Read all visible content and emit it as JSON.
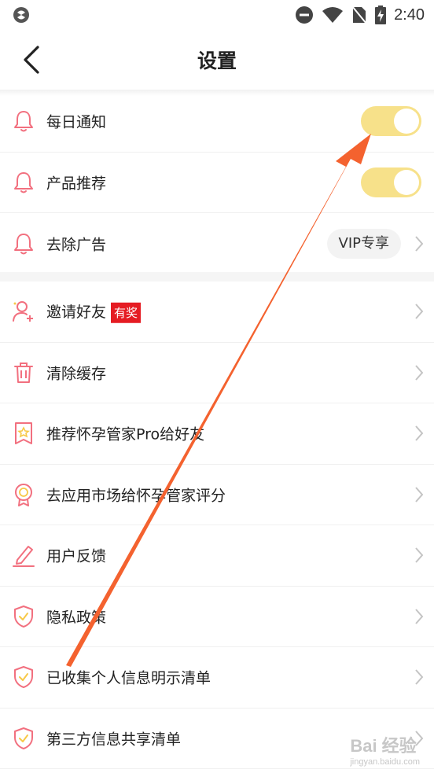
{
  "status_bar": {
    "time": "2:40",
    "icons": [
      "app-notification-icon",
      "do-not-disturb-icon",
      "wifi-icon",
      "no-sim-icon",
      "battery-charging-icon"
    ]
  },
  "header": {
    "title": "设置",
    "back_icon": "back-arrow-icon"
  },
  "colors": {
    "accent_pink": "#f2707f",
    "toggle_on": "#f7e18a",
    "badge_red": "#e51c23",
    "annotation_arrow": "#f4622f"
  },
  "section1": [
    {
      "label": "每日通知",
      "icon": "bell-icon",
      "control": "toggle",
      "state": "on"
    },
    {
      "label": "产品推荐",
      "icon": "bell-icon",
      "control": "toggle",
      "state": "on"
    },
    {
      "label": "去除广告",
      "icon": "bell-icon",
      "control": "pill",
      "pill_label": "VIP专享"
    }
  ],
  "section2": [
    {
      "label": "邀请好友",
      "icon": "add-user-icon",
      "badge": "有奖"
    },
    {
      "label": "清除缓存",
      "icon": "trash-icon"
    },
    {
      "label": "推荐怀孕管家Pro给好友",
      "icon": "share-card-icon"
    },
    {
      "label": "去应用市场给怀孕管家评分",
      "icon": "medal-icon"
    },
    {
      "label": "用户反馈",
      "icon": "pencil-icon"
    },
    {
      "label": "隐私政策",
      "icon": "shield-check-icon"
    },
    {
      "label": "已收集个人信息明示清单",
      "icon": "shield-check-icon"
    },
    {
      "label": "第三方信息共享清单",
      "icon": "shield-check-icon"
    }
  ],
  "watermark": {
    "main": "Bai 经验",
    "sub": "jingyan.baidu.com"
  }
}
